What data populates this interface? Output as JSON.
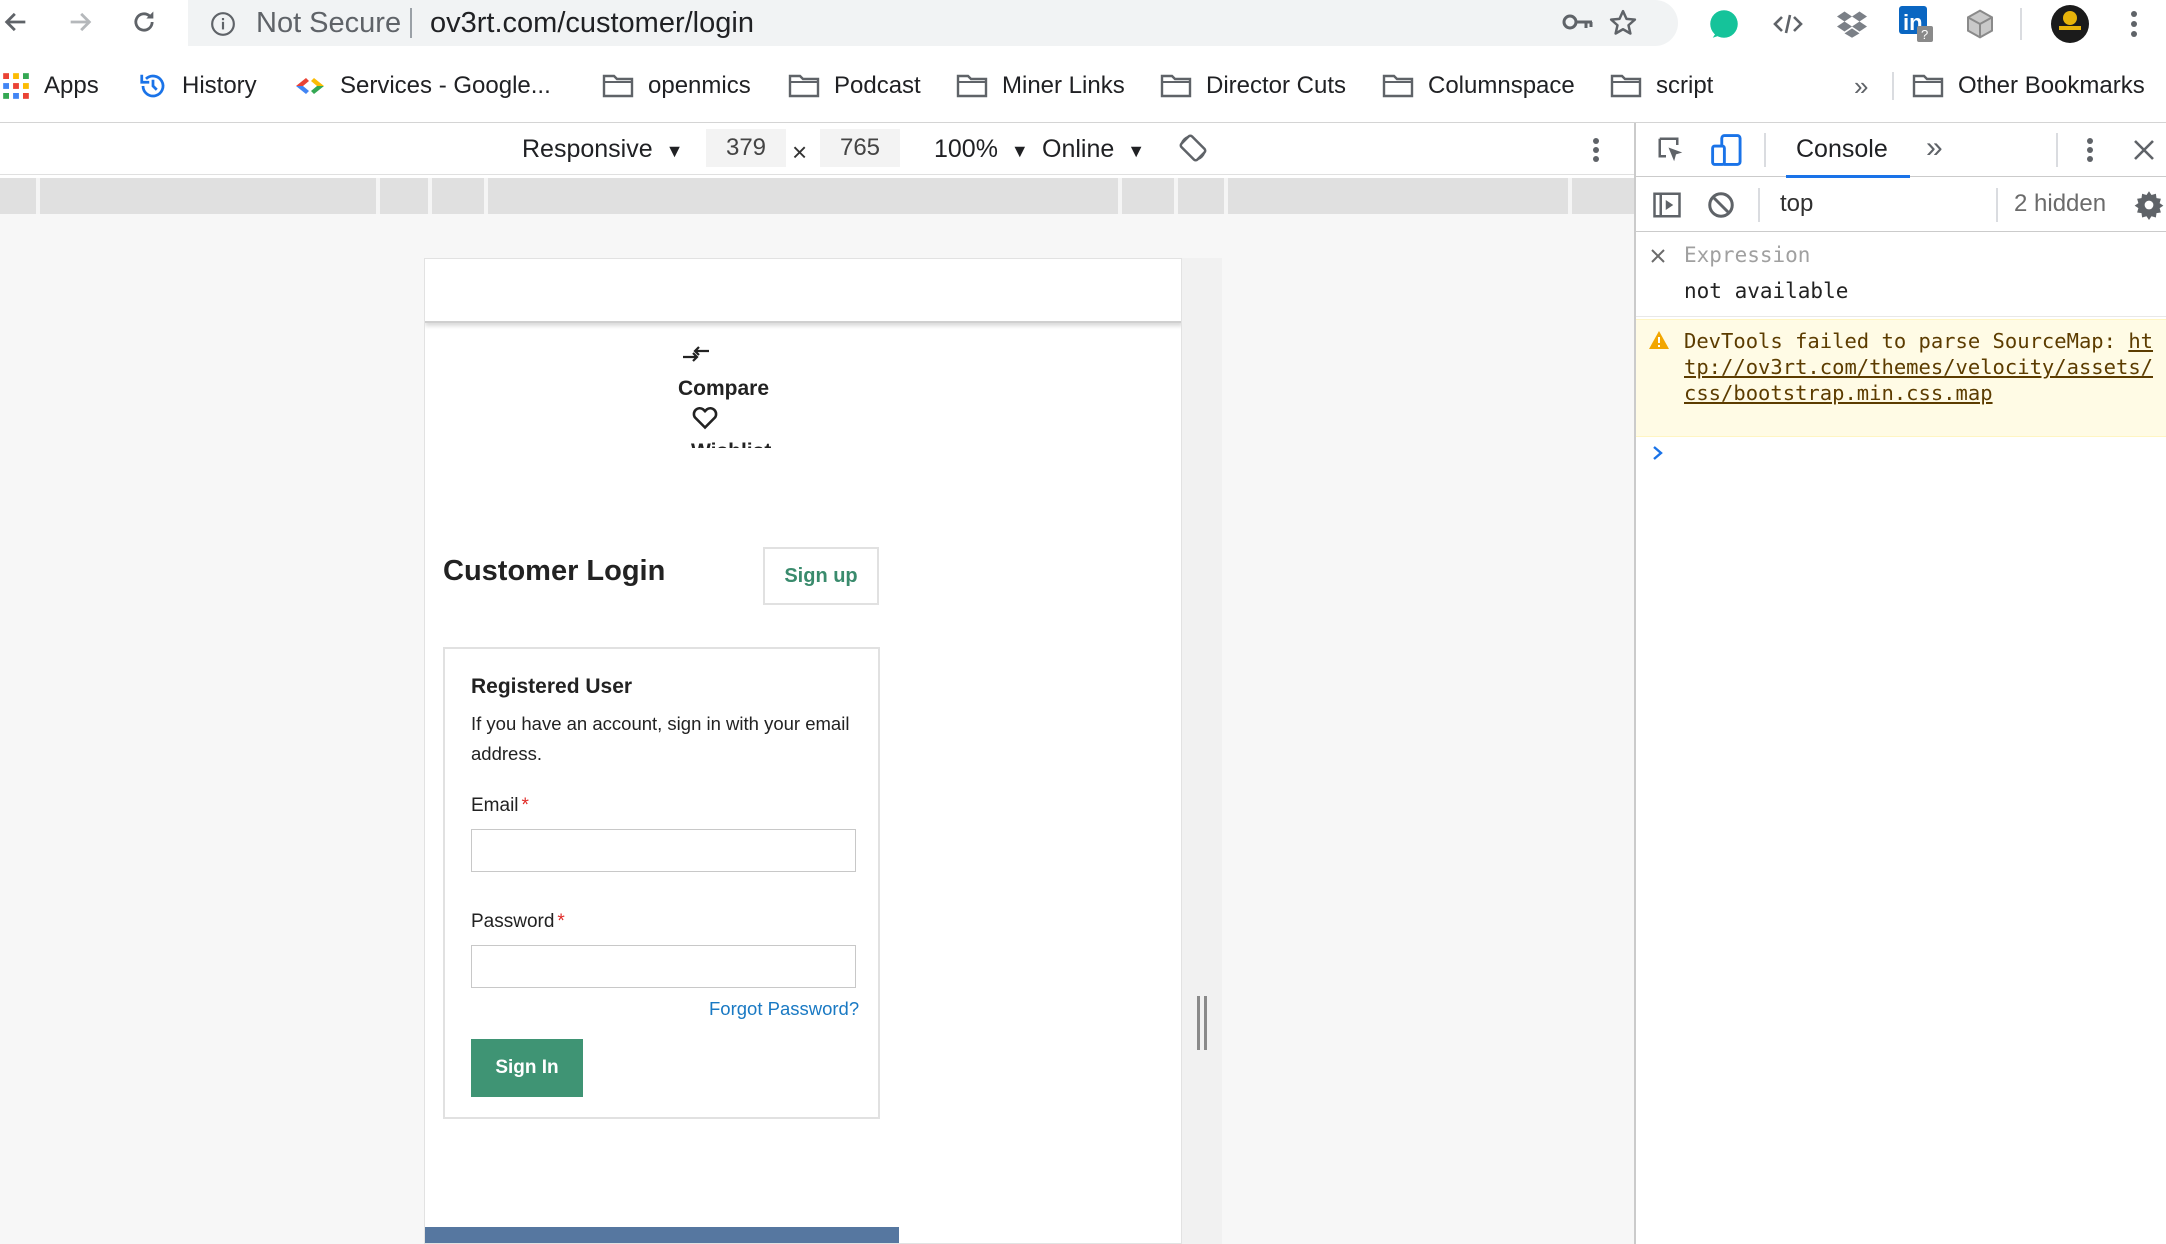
{
  "browser": {
    "security_label": "Not Secure",
    "url": "ov3rt.com/customer/login"
  },
  "bookmarks": {
    "items": [
      "Apps",
      "History",
      "Services - Google...",
      "openmics",
      "Podcast",
      "Miner Links",
      "Director Cuts",
      "Columnspace",
      "script"
    ],
    "overflow": "»",
    "other": "Other Bookmarks"
  },
  "device_toolbar": {
    "mode": "Responsive",
    "width": "379",
    "times": "×",
    "height": "765",
    "zoom": "100%",
    "network": "Online"
  },
  "page": {
    "compare_label": "Compare",
    "wishlist_label": "Wishlist",
    "title": "Customer Login",
    "signup_label": "Sign up",
    "registered_title": "Registered User",
    "registered_desc": "If you have an account, sign in with your email address.",
    "email_label": "Email",
    "password_label": "Password",
    "required_mark": "*",
    "forgot_label": "Forgot Password?",
    "signin_label": "Sign In"
  },
  "devtools": {
    "active_tab": "Console",
    "more_tabs": "»",
    "context": "top",
    "hidden_count": "2 hidden",
    "expression_label": "Expression",
    "expression_value": "not available",
    "warning_prefix": "DevTools failed to parse SourceMap: ",
    "warning_link": "http://ov3rt.com/themes/velocity/assets/css/bootstrap.min.css.map"
  },
  "colors": {
    "accent_green": "#3f9474",
    "link_blue": "#1979c3",
    "required_red": "#e02b27",
    "devtools_blue": "#1a73e8",
    "warning_bg": "#fffbe5"
  }
}
